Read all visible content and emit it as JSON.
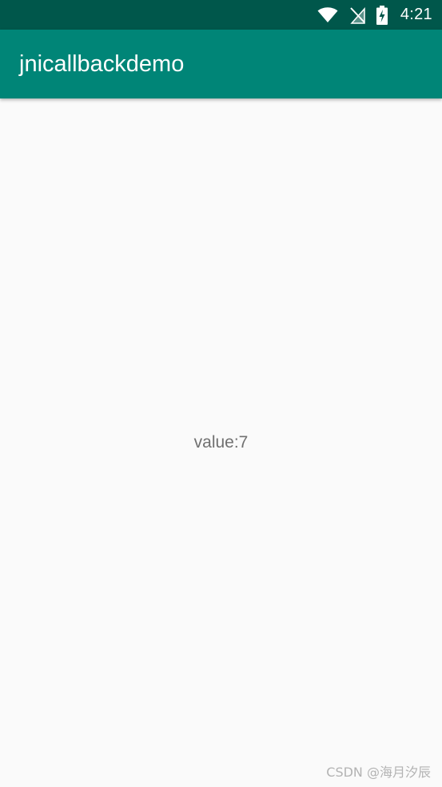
{
  "status_bar": {
    "time": "4:21",
    "icons": [
      "wifi-icon",
      "no-signal-icon",
      "battery-charging-icon"
    ],
    "background_color": "#00574b"
  },
  "app_bar": {
    "title": "jnicallbackdemo",
    "background_color": "#008577"
  },
  "main": {
    "value_text": "value:7"
  },
  "watermark": {
    "text": "CSDN @海月汐辰"
  }
}
